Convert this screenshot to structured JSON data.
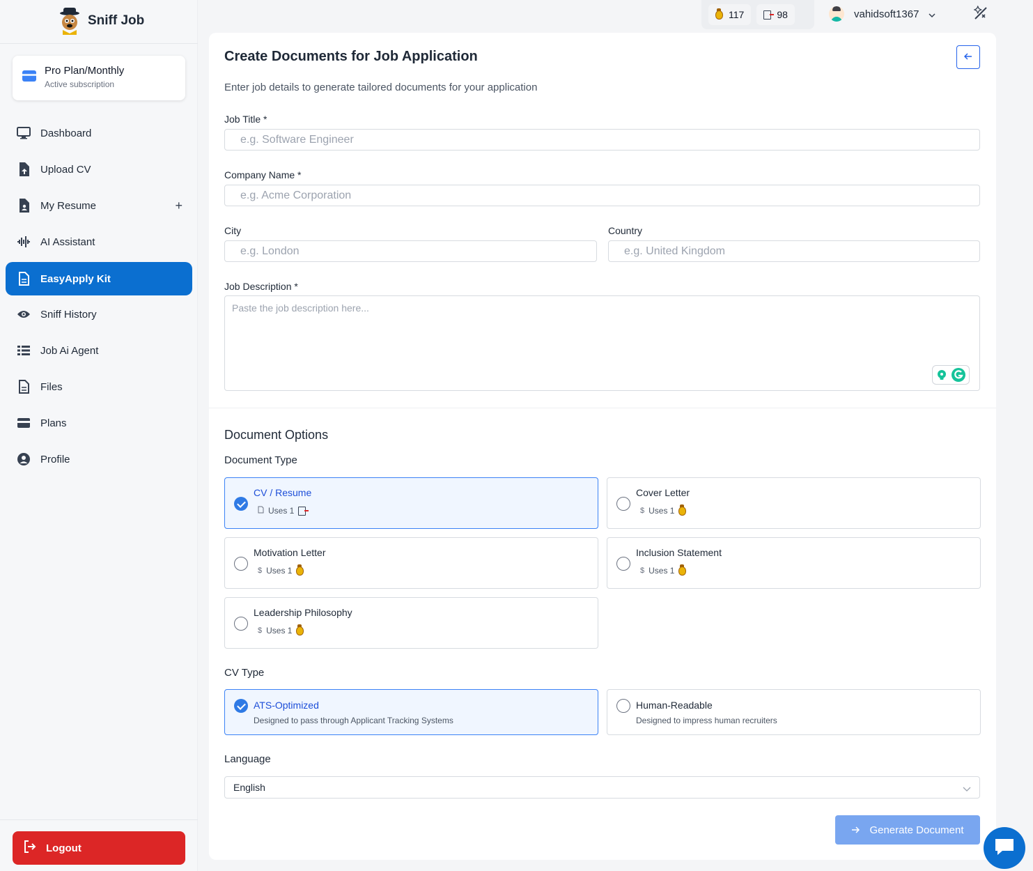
{
  "app": {
    "name": "Sniff Job"
  },
  "plan": {
    "title": "Pro Plan/Monthly",
    "status": "Active subscription"
  },
  "sidebar": {
    "items": [
      {
        "label": "Dashboard",
        "icon": "monitor-icon"
      },
      {
        "label": "Upload CV",
        "icon": "file-upload-icon"
      },
      {
        "label": "My Resume",
        "icon": "file-user-icon",
        "action": "+"
      },
      {
        "label": "AI Assistant",
        "icon": "sound-wave-icon"
      },
      {
        "label": "EasyApply Kit",
        "icon": "document-icon",
        "active": true
      },
      {
        "label": "Sniff History",
        "icon": "eye-icon"
      },
      {
        "label": "Job Ai Agent",
        "icon": "list-icon"
      },
      {
        "label": "Files",
        "icon": "file-icon"
      },
      {
        "label": "Plans",
        "icon": "credit-card-icon"
      },
      {
        "label": "Profile",
        "icon": "user-circle-icon"
      }
    ],
    "logout": "Logout"
  },
  "header": {
    "coins": "117",
    "documents": "98",
    "username": "vahidsoft1367"
  },
  "form": {
    "title": "Create Documents for Job Application",
    "subtitle": "Enter job details to generate tailored documents for your application",
    "job_title_label": "Job Title *",
    "job_title_placeholder": "e.g. Software Engineer",
    "company_label": "Company Name *",
    "company_placeholder": "e.g. Acme Corporation",
    "city_label": "City",
    "city_placeholder": "e.g. London",
    "country_label": "Country",
    "country_placeholder": "e.g. United Kingdom",
    "description_label": "Job Description *",
    "description_placeholder": "Paste the job description here..."
  },
  "options": {
    "section_title": "Document Options",
    "doc_type_label": "Document Type",
    "doc_types": [
      {
        "title": "CV / Resume",
        "uses": "Uses 1",
        "selected": true
      },
      {
        "title": "Cover Letter",
        "uses": "Uses 1",
        "selected": false
      },
      {
        "title": "Motivation Letter",
        "uses": "Uses 1",
        "selected": false
      },
      {
        "title": "Inclusion Statement",
        "uses": "Uses 1",
        "selected": false
      },
      {
        "title": "Leadership Philosophy",
        "uses": "Uses 1",
        "selected": false
      }
    ],
    "cv_type_label": "CV Type",
    "cv_types": [
      {
        "title": "ATS-Optimized",
        "desc": "Designed to pass through Applicant Tracking Systems",
        "selected": true
      },
      {
        "title": "Human-Readable",
        "desc": "Designed to impress human recruiters",
        "selected": false
      }
    ],
    "language_label": "Language",
    "language_value": "English",
    "generate_label": "Generate Document"
  },
  "colors": {
    "accent": "#0b6fd0",
    "danger": "#dc2626",
    "button_disabled": "#79a6f0"
  }
}
